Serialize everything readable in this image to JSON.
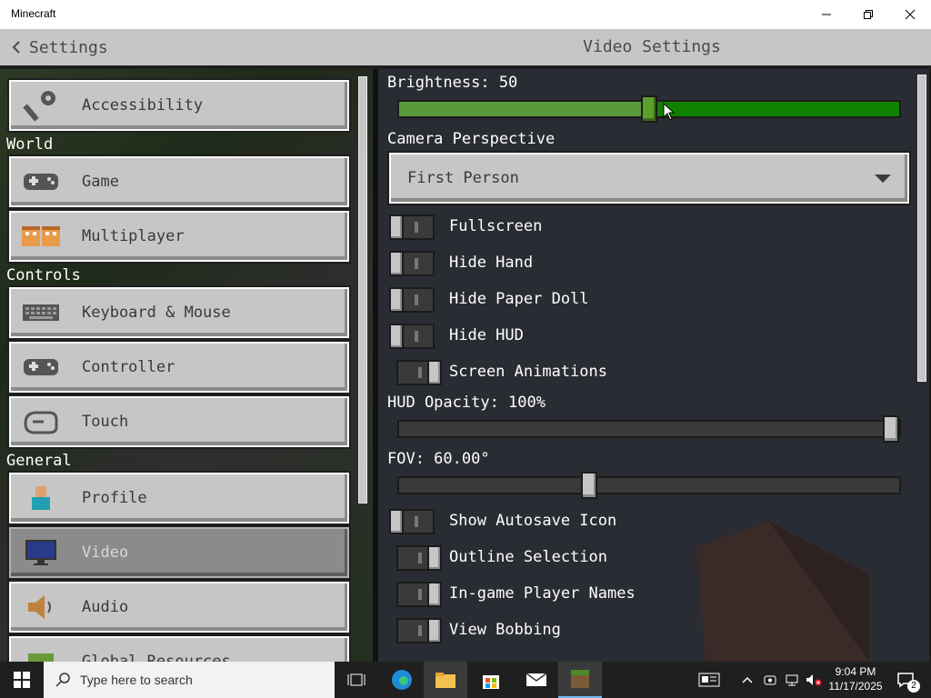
{
  "window": {
    "title": "Minecraft"
  },
  "header": {
    "back_label": "Settings",
    "title": "Video Settings"
  },
  "left_nav": {
    "items": [
      {
        "label": "Accessibility"
      },
      {
        "section": "World"
      },
      {
        "label": "Game"
      },
      {
        "label": "Multiplayer"
      },
      {
        "section": "Controls"
      },
      {
        "label": "Keyboard & Mouse"
      },
      {
        "label": "Controller"
      },
      {
        "label": "Touch"
      },
      {
        "section": "General"
      },
      {
        "label": "Profile"
      },
      {
        "label": "Video",
        "active": true
      },
      {
        "label": "Audio"
      },
      {
        "label": "Global Resources"
      }
    ]
  },
  "video": {
    "brightness_label": "Brightness: 50",
    "brightness_value": 50,
    "camera_label": "Camera Perspective",
    "camera_value": "First Person",
    "toggles": [
      {
        "label": "Fullscreen",
        "on": false
      },
      {
        "label": "Hide Hand",
        "on": false
      },
      {
        "label": "Hide Paper Doll",
        "on": false
      },
      {
        "label": "Hide HUD",
        "on": false
      },
      {
        "label": "Screen Animations",
        "on": true
      }
    ],
    "hud_opacity_label": "HUD Opacity: 100%",
    "hud_opacity_value": 1.0,
    "fov_label": "FOV: 60.00°",
    "fov_fraction": 0.38,
    "toggles2": [
      {
        "label": "Show Autosave Icon",
        "on": false
      },
      {
        "label": "Outline Selection",
        "on": true
      },
      {
        "label": "In-game Player Names",
        "on": true
      },
      {
        "label": "View Bobbing",
        "on": true
      }
    ]
  },
  "taskbar": {
    "search_placeholder": "Type here to search",
    "time": "9:04 PM",
    "date": "11/17/2025",
    "notification_count": "2"
  },
  "colors": {
    "accent_green": "#5aa02c",
    "slider_green": "#108000",
    "panel": "#2a2c33"
  }
}
